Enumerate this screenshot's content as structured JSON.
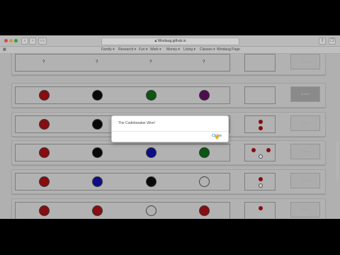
{
  "browser": {
    "url": "Windaug.github.io",
    "bookmarks": [
      "Family ▾",
      "Research ▾",
      "Fun ▾",
      "Work ▾",
      "Money ▾",
      "Living ▾",
      "Classes ▾",
      "Windaug Page"
    ]
  },
  "board": {
    "placeholder": "?",
    "check_label": "Submit",
    "colors": {
      "red": "#a60f14",
      "black": "#0a0a0a",
      "green": "#0b6b17",
      "purple": "#5e1062",
      "blue": "#1212a8",
      "empty": "transparent"
    },
    "rows": [
      {
        "pegs": [
          "?",
          "?",
          "?",
          "?"
        ],
        "hints": []
      },
      {
        "pegs": [
          "red",
          "black",
          "green",
          "purple"
        ],
        "hints": []
      },
      {
        "pegs": [
          "red",
          "black",
          "empty",
          "empty"
        ],
        "hints": [
          "red",
          "red"
        ]
      },
      {
        "pegs": [
          "red",
          "black",
          "blue",
          "green"
        ],
        "hints": [
          "red",
          "red",
          "white"
        ]
      },
      {
        "pegs": [
          "red",
          "blue",
          "black",
          "empty"
        ],
        "hints": [
          "red",
          "white"
        ]
      },
      {
        "pegs": [
          "red",
          "red",
          "empty",
          "red"
        ],
        "hints": [
          "red"
        ]
      }
    ]
  },
  "dialog": {
    "message": "The Codebreaker Won!",
    "close_label": "Close"
  }
}
